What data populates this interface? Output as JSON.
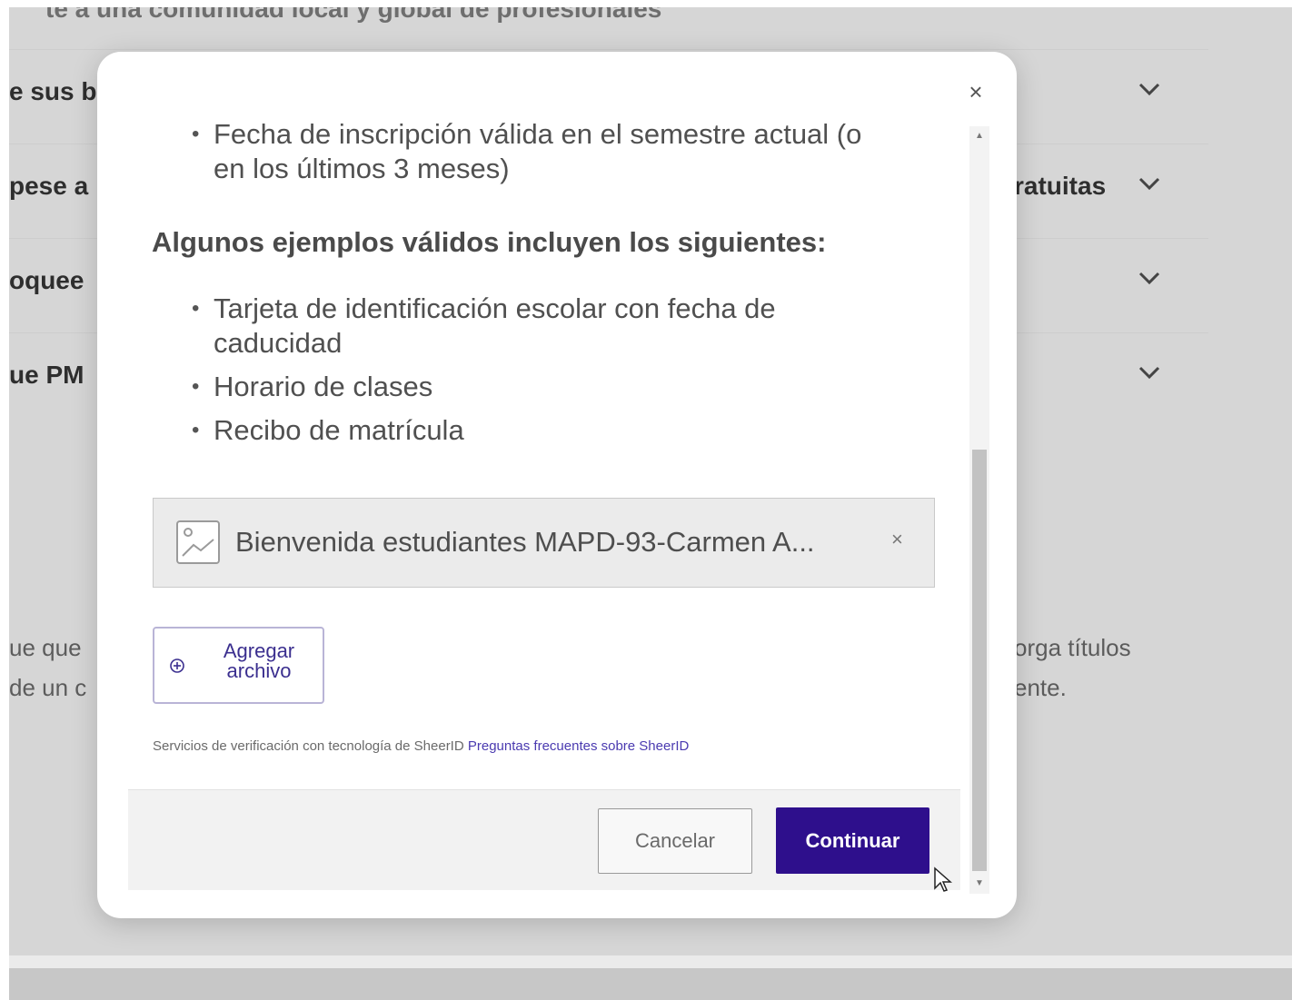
{
  "background": {
    "top_text": "te a una comunidad local y global de profesionales",
    "rows": [
      {
        "left": "e sus b",
        "right": ""
      },
      {
        "left": "pese a",
        "right": "ratuitas"
      },
      {
        "left": "oquee",
        "right": ""
      },
      {
        "left": "ue PM",
        "right": ""
      }
    ],
    "para_left": [
      "ue que",
      "de un c"
    ],
    "para_right": [
      "orga títulos",
      "ente."
    ]
  },
  "modal": {
    "close_icon": "×",
    "requirements_tail": [
      "Fecha de inscripción válida en el semestre actual (o en los últimos 3 meses)"
    ],
    "examples_heading": "Algunos ejemplos válidos incluyen los siguientes:",
    "examples": [
      "Tarjeta de identificación escolar con fecha de caducidad",
      "Horario de clases",
      "Recibo de matrícula"
    ],
    "uploaded_file": {
      "name": "Bienvenida estudiantes MAPD-93-Carmen A...",
      "remove": "×"
    },
    "add_file_label": "Agregar archivo",
    "powered_text": "Servicios de verificación con tecnología de SheerID",
    "faq_link": "Preguntas frecuentes sobre SheerID",
    "cancel_label": "Cancelar",
    "continue_label": "Continuar",
    "scroll_up": "▲",
    "scroll_down": "▼"
  },
  "colors": {
    "primary": "#2e0f8c",
    "link": "#4a3ab0"
  }
}
